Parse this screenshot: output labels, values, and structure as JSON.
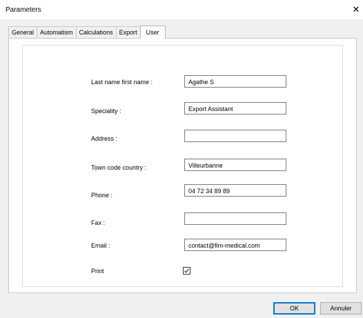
{
  "window": {
    "title": "Parameters",
    "close_glyph": "✕"
  },
  "tabs": [
    {
      "label": "General",
      "active": false
    },
    {
      "label": "Automatism",
      "active": false
    },
    {
      "label": "Calculations",
      "active": false
    },
    {
      "label": "Export",
      "active": false
    },
    {
      "label": "User",
      "active": true
    }
  ],
  "form": {
    "last_name_first_name": {
      "label": "Last name first name :",
      "value": "Agathe S"
    },
    "speciality": {
      "label": "Speciality :",
      "value": "Export Assistant"
    },
    "address": {
      "label": "Address :",
      "value": ""
    },
    "town_code_country": {
      "label": "Town code country :",
      "value": "Villeurbanne"
    },
    "phone": {
      "label": "Phone :",
      "value": "04 72 34 89 89"
    },
    "fax": {
      "label": "Fax :",
      "value": ""
    },
    "email": {
      "label": "Email :",
      "value": "contact@fim-medical.com"
    },
    "print": {
      "label": "Print",
      "checked": true
    }
  },
  "buttons": {
    "ok": "OK",
    "cancel": "Annuler"
  },
  "colors": {
    "accent": "#0078d7",
    "panel_bg": "#ffffff",
    "window_bg": "#f0f0f0"
  }
}
